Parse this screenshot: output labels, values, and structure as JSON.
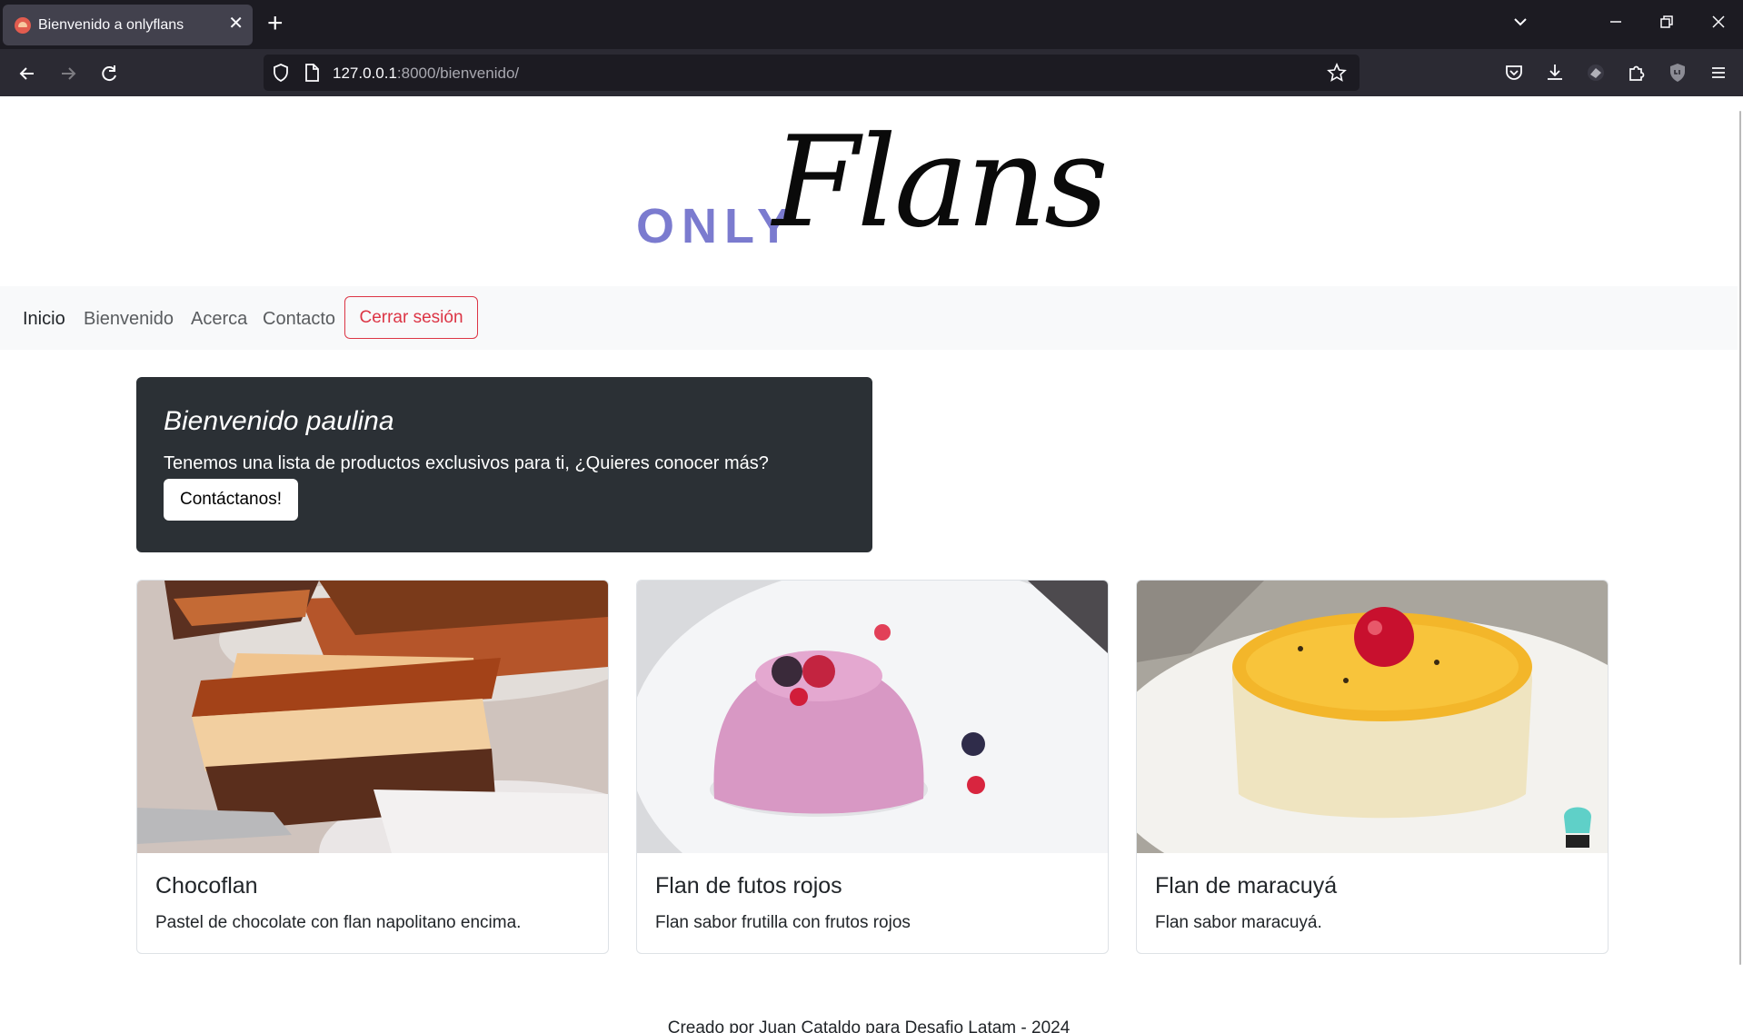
{
  "browser": {
    "tab_title": "Bienvenido a onlyflans",
    "tab_close": "✕",
    "new_tab": "+",
    "url_host": "127.0.0.1",
    "url_rest": ":8000/bienvenido/"
  },
  "logo": {
    "only": "ONLY",
    "flans": "Flans",
    "colors": {
      "only": "#7b7bcf",
      "flans": "#0a0a0a"
    }
  },
  "nav": {
    "links": [
      "Inicio",
      "Bienvenido",
      "Acerca",
      "Contacto"
    ],
    "logout_label": "Cerrar sesión"
  },
  "welcome": {
    "title": "Bienvenido paulina",
    "text": "Tenemos una lista de productos exclusivos para ti, ¿Quieres conocer más?",
    "button": "Contáctanos!"
  },
  "products": [
    {
      "title": "Chocoflan",
      "description": "Pastel de chocolate con flan napolitano encima."
    },
    {
      "title": "Flan de futos rojos",
      "description": "Flan sabor frutilla con frutos rojos"
    },
    {
      "title": "Flan de maracuyá",
      "description": "Flan sabor maracuyá."
    }
  ],
  "footer": {
    "text": "Creado por Juan Cataldo para Desafio Latam - 2024"
  },
  "colors": {
    "accent_danger": "#dc3545",
    "welcome_bg": "#2b3035",
    "nav_bg": "#f8f9fa"
  }
}
